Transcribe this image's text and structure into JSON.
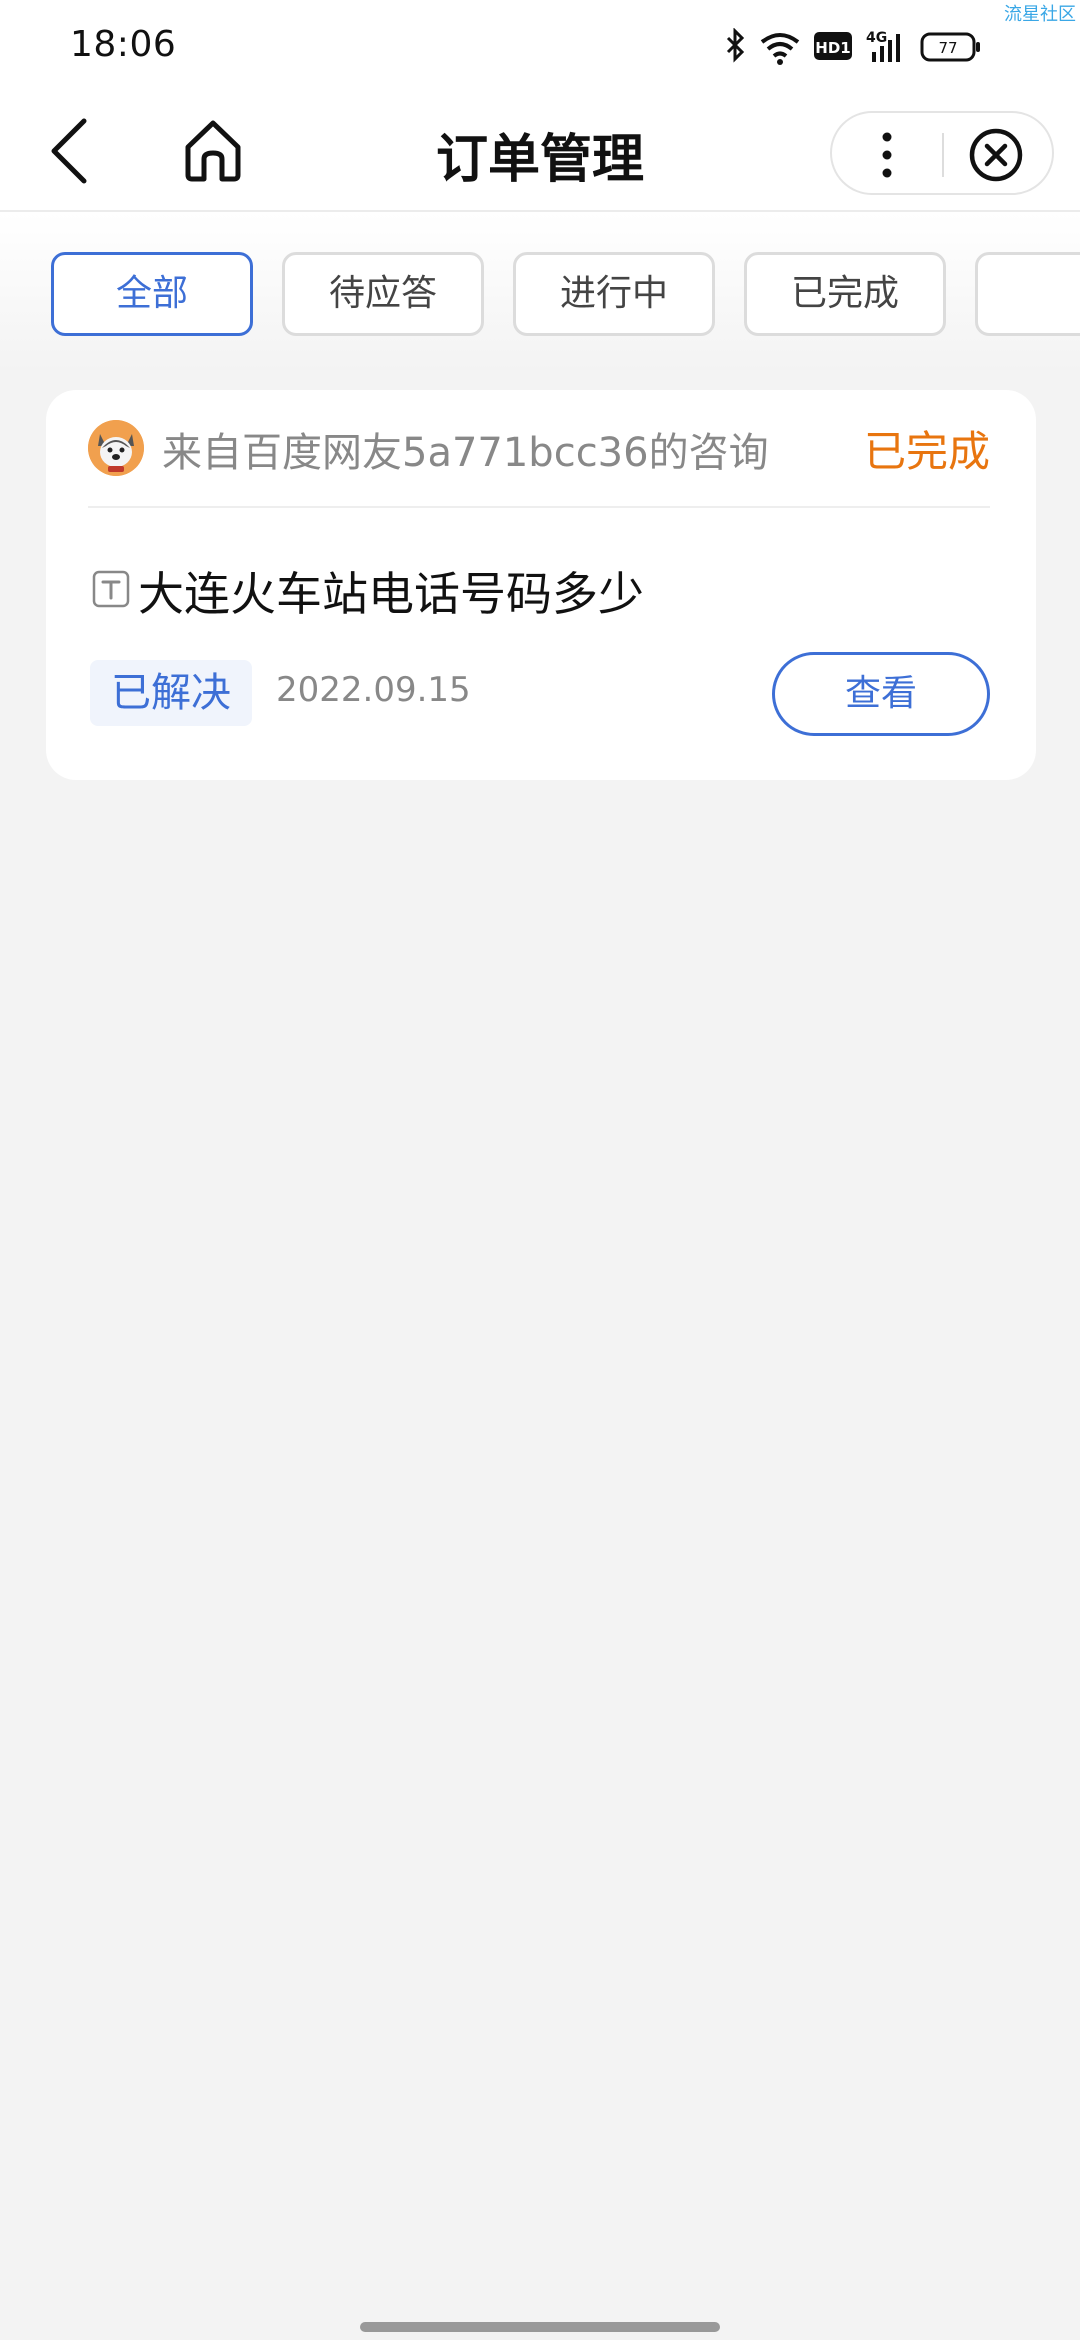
{
  "status_bar": {
    "time": "18:06",
    "battery": "77",
    "network": "4G",
    "hd": "HD1",
    "watermark": "流星社区"
  },
  "header": {
    "title": "订单管理",
    "back_icon": "chevron-left-icon",
    "home_icon": "home-icon",
    "more_icon": "more-vertical-icon",
    "close_icon": "close-circle-icon"
  },
  "tabs": [
    {
      "label": "全部",
      "active": true
    },
    {
      "label": "待应答",
      "active": false
    },
    {
      "label": "进行中",
      "active": false
    },
    {
      "label": "已完成",
      "active": false
    }
  ],
  "orders": [
    {
      "from": "来自百度网友5a771bcc36的咨询",
      "status": "已完成",
      "question": "大连火车站电话号码多少",
      "badge": "已解决",
      "date": "2022.09.15",
      "action": "查看"
    }
  ],
  "colors": {
    "accent": "#3d6fd6",
    "status_done": "#e8750f",
    "background": "#f3f3f3"
  }
}
